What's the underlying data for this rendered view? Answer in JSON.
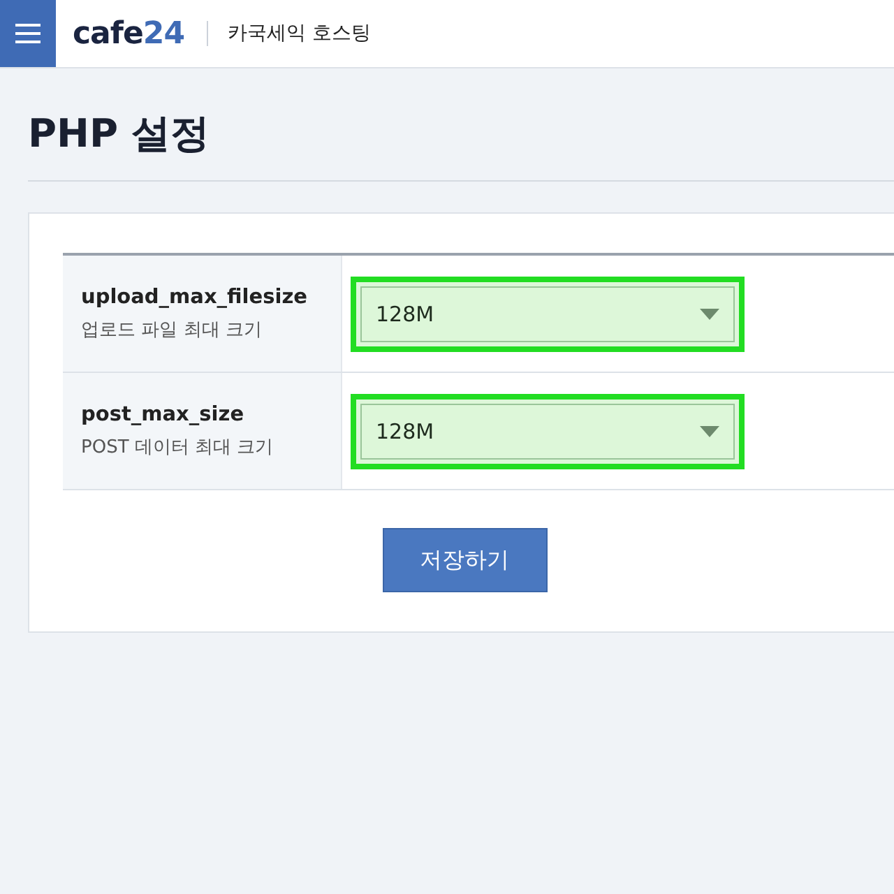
{
  "header": {
    "logo": {
      "main": "cafe",
      "accent": "24"
    },
    "service": "카국세익 호스팅"
  },
  "page_title": "PHP 설정",
  "settings": [
    {
      "name": "upload_max_filesize",
      "description": "업로드 파일 최대 크기",
      "value": "128M",
      "highlighted": true
    },
    {
      "name": "post_max_size",
      "description": "POST 데이터 최대 크기",
      "value": "128M",
      "highlighted": true
    }
  ],
  "save_button": "저장하기"
}
